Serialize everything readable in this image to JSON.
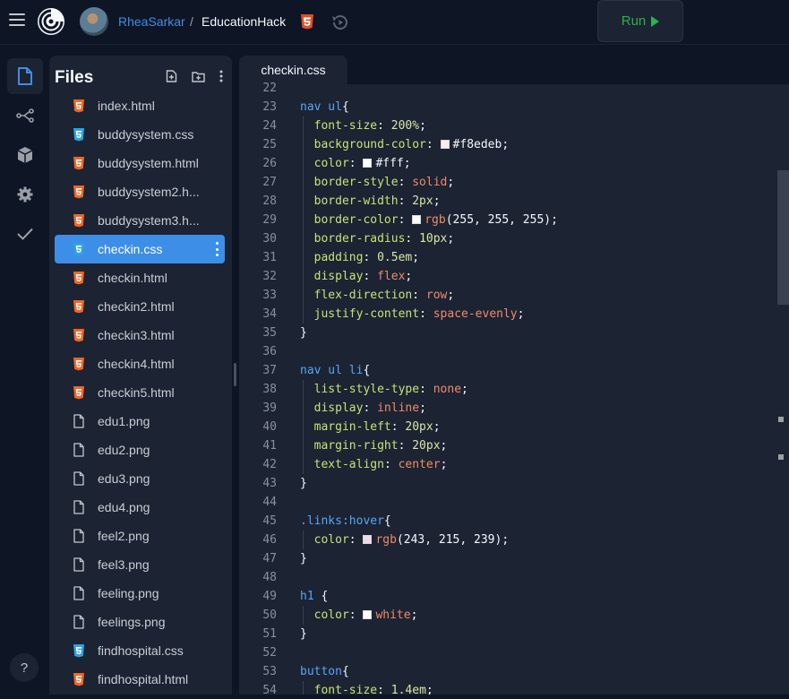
{
  "header": {
    "username": "RheaSarkar",
    "separator": "/",
    "project_name": "EducationHack",
    "run_label": "Run"
  },
  "icons": {
    "menu": "hamburger-icon",
    "logo": "replit-spiral-logo",
    "language": "html5-icon",
    "history": "history-icon",
    "run": "play-icon"
  },
  "rail": {
    "items": [
      "files-icon",
      "git-branch-icon",
      "packages-icon",
      "settings-icon",
      "checkmark-icon"
    ],
    "help_label": "?"
  },
  "files_panel": {
    "title": "Files",
    "items": [
      {
        "name": "index.html",
        "type": "html"
      },
      {
        "name": "buddysystem.css",
        "type": "css"
      },
      {
        "name": "buddysystem.html",
        "type": "html"
      },
      {
        "name": "buddysystem2.h...",
        "type": "html"
      },
      {
        "name": "buddysystem3.h...",
        "type": "html"
      },
      {
        "name": "checkin.css",
        "type": "css",
        "selected": true
      },
      {
        "name": "checkin.html",
        "type": "html"
      },
      {
        "name": "checkin2.html",
        "type": "html"
      },
      {
        "name": "checkin3.html",
        "type": "html"
      },
      {
        "name": "checkin4.html",
        "type": "html"
      },
      {
        "name": "checkin5.html",
        "type": "html"
      },
      {
        "name": "edu1.png",
        "type": "file"
      },
      {
        "name": "edu2.png",
        "type": "file"
      },
      {
        "name": "edu3.png",
        "type": "file"
      },
      {
        "name": "edu4.png",
        "type": "file"
      },
      {
        "name": "feel2.png",
        "type": "file"
      },
      {
        "name": "feel3.png",
        "type": "file"
      },
      {
        "name": "feeling.png",
        "type": "file"
      },
      {
        "name": "feelings.png",
        "type": "file"
      },
      {
        "name": "findhospital.css",
        "type": "css"
      },
      {
        "name": "findhospital.html",
        "type": "html"
      }
    ]
  },
  "colors": {
    "html_icon": "#f26522",
    "css_icon": "#2aa4e8",
    "file_icon": "#c2c8cc",
    "selected_bg": "#3d8ee6",
    "run_green": "#2bb24c"
  },
  "editor": {
    "tab_label": "checkin.css",
    "lines": [
      {
        "n": 22,
        "t": []
      },
      {
        "n": 23,
        "t": [
          [
            "sel",
            "nav ul"
          ],
          [
            "plain",
            "{"
          ]
        ]
      },
      {
        "n": 24,
        "g": 1,
        "t": [
          [
            "prop",
            "font-size"
          ],
          [
            "plain",
            ": "
          ],
          [
            "num",
            "200%"
          ],
          [
            "plain",
            ";"
          ]
        ]
      },
      {
        "n": 25,
        "g": 1,
        "t": [
          [
            "prop",
            "background-color"
          ],
          [
            "plain",
            ": "
          ],
          [
            "sw",
            "#f8edeb"
          ],
          [
            "plain",
            "#f8edeb;"
          ]
        ]
      },
      {
        "n": 26,
        "g": 1,
        "t": [
          [
            "prop",
            "color"
          ],
          [
            "plain",
            ": "
          ],
          [
            "sw",
            "#ffffff"
          ],
          [
            "plain",
            "#fff;"
          ]
        ]
      },
      {
        "n": 27,
        "g": 1,
        "t": [
          [
            "prop",
            "border-style"
          ],
          [
            "plain",
            ": "
          ],
          [
            "val",
            "solid"
          ],
          [
            "plain",
            ";"
          ]
        ]
      },
      {
        "n": 28,
        "g": 1,
        "t": [
          [
            "prop",
            "border-width"
          ],
          [
            "plain",
            ": "
          ],
          [
            "num",
            "2px"
          ],
          [
            "plain",
            ";"
          ]
        ]
      },
      {
        "n": 29,
        "g": 1,
        "t": [
          [
            "prop",
            "border-color"
          ],
          [
            "plain",
            ": "
          ],
          [
            "sw",
            "#ffffff"
          ],
          [
            "val",
            "rgb"
          ],
          [
            "plain",
            "(255, 255, 255);"
          ]
        ]
      },
      {
        "n": 30,
        "g": 1,
        "t": [
          [
            "prop",
            "border-radius"
          ],
          [
            "plain",
            ": "
          ],
          [
            "num",
            "10px"
          ],
          [
            "plain",
            ";"
          ]
        ]
      },
      {
        "n": 31,
        "g": 1,
        "t": [
          [
            "prop",
            "padding"
          ],
          [
            "plain",
            ": "
          ],
          [
            "num",
            "0.5em"
          ],
          [
            "plain",
            ";"
          ]
        ]
      },
      {
        "n": 32,
        "g": 1,
        "t": [
          [
            "prop",
            "display"
          ],
          [
            "plain",
            ": "
          ],
          [
            "val",
            "flex"
          ],
          [
            "plain",
            ";"
          ]
        ]
      },
      {
        "n": 33,
        "g": 1,
        "t": [
          [
            "prop",
            "flex-direction"
          ],
          [
            "plain",
            ": "
          ],
          [
            "val",
            "row"
          ],
          [
            "plain",
            ";"
          ]
        ]
      },
      {
        "n": 34,
        "g": 1,
        "t": [
          [
            "prop",
            "justify-content"
          ],
          [
            "plain",
            ": "
          ],
          [
            "val",
            "space-evenly"
          ],
          [
            "plain",
            ";"
          ]
        ]
      },
      {
        "n": 35,
        "t": [
          [
            "plain",
            "}"
          ]
        ]
      },
      {
        "n": 36,
        "t": []
      },
      {
        "n": 37,
        "t": [
          [
            "sel",
            "nav ul li"
          ],
          [
            "plain",
            "{"
          ]
        ]
      },
      {
        "n": 38,
        "g": 1,
        "t": [
          [
            "prop",
            "list-style-type"
          ],
          [
            "plain",
            ": "
          ],
          [
            "val",
            "none"
          ],
          [
            "plain",
            ";"
          ]
        ]
      },
      {
        "n": 39,
        "g": 1,
        "t": [
          [
            "prop",
            "display"
          ],
          [
            "plain",
            ": "
          ],
          [
            "val",
            "inline"
          ],
          [
            "plain",
            ";"
          ]
        ]
      },
      {
        "n": 40,
        "g": 1,
        "t": [
          [
            "prop",
            "margin-left"
          ],
          [
            "plain",
            ": "
          ],
          [
            "num",
            "20px"
          ],
          [
            "plain",
            ";"
          ]
        ]
      },
      {
        "n": 41,
        "g": 1,
        "t": [
          [
            "prop",
            "margin-right"
          ],
          [
            "plain",
            ": "
          ],
          [
            "num",
            "20px"
          ],
          [
            "plain",
            ";"
          ]
        ]
      },
      {
        "n": 42,
        "g": 1,
        "t": [
          [
            "prop",
            "text-align"
          ],
          [
            "plain",
            ": "
          ],
          [
            "val",
            "center"
          ],
          [
            "plain",
            ";"
          ]
        ]
      },
      {
        "n": 43,
        "t": [
          [
            "plain",
            "}"
          ]
        ]
      },
      {
        "n": 44,
        "t": []
      },
      {
        "n": 45,
        "t": [
          [
            "sel",
            ".links:hover"
          ],
          [
            "plain",
            "{"
          ]
        ]
      },
      {
        "n": 46,
        "g": 1,
        "t": [
          [
            "prop",
            "color"
          ],
          [
            "plain",
            ": "
          ],
          [
            "sw",
            "#f3d7ef"
          ],
          [
            "val",
            "rgb"
          ],
          [
            "plain",
            "(243, 215, 239);"
          ]
        ]
      },
      {
        "n": 47,
        "t": [
          [
            "plain",
            "}"
          ]
        ]
      },
      {
        "n": 48,
        "t": []
      },
      {
        "n": 49,
        "t": [
          [
            "sel",
            "h1"
          ],
          [
            "plain",
            " {"
          ]
        ]
      },
      {
        "n": 50,
        "g": 1,
        "t": [
          [
            "prop",
            "color"
          ],
          [
            "plain",
            ": "
          ],
          [
            "sw",
            "#ffffff"
          ],
          [
            "val",
            "white"
          ],
          [
            "plain",
            ";"
          ]
        ]
      },
      {
        "n": 51,
        "t": [
          [
            "plain",
            "}"
          ]
        ]
      },
      {
        "n": 52,
        "t": []
      },
      {
        "n": 53,
        "t": [
          [
            "sel",
            "button"
          ],
          [
            "plain",
            "{"
          ]
        ]
      },
      {
        "n": 54,
        "g": 1,
        "t": [
          [
            "prop",
            "font-size"
          ],
          [
            "plain",
            ": "
          ],
          [
            "num",
            "1.4em"
          ],
          [
            "plain",
            ";"
          ]
        ]
      }
    ]
  }
}
